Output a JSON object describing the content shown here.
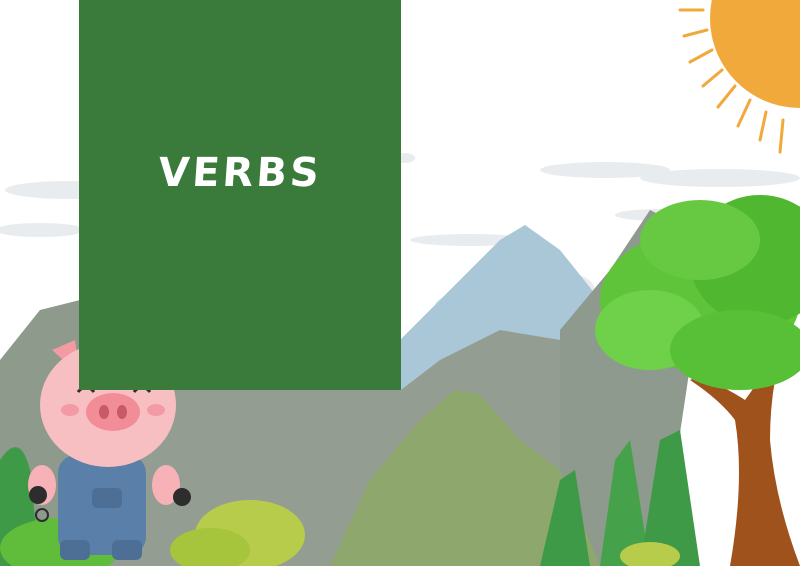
{
  "title": "VERBS",
  "colors": {
    "card": "#3a7a3a",
    "sky": "#ffffff",
    "sun": "#f2a93b",
    "mountain": "#8f9a8a",
    "far_mountain": "#a8c8d8",
    "tree_leaves": "#5fc43a",
    "trunk": "#a0521d",
    "pig": "#f7b2b7",
    "overalls": "#5a7fa8"
  },
  "icons": [
    "sun-illustration",
    "pig-illustration",
    "tree-illustration",
    "mountain-illustration",
    "cloud-illustration"
  ]
}
